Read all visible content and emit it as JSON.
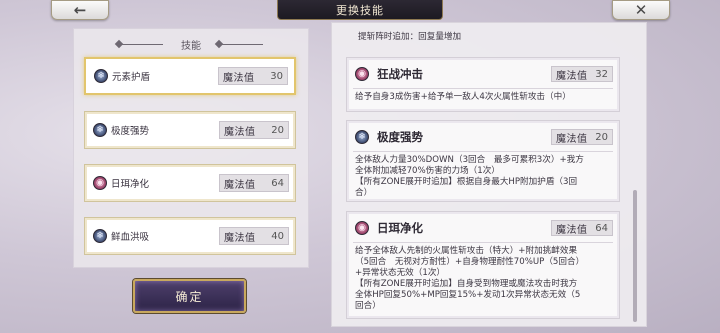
{
  "header": {
    "title": "更换技能",
    "back_icon": "arrow-left-icon",
    "close_icon": "close-icon"
  },
  "left_panel": {
    "title": "技能",
    "slots": [
      {
        "name": "元素护盾",
        "mp_label": "魔法值",
        "mp": "30",
        "icon": "shield-rune-icon"
      },
      {
        "name": "极度强势",
        "mp_label": "魔法值",
        "mp": "20",
        "icon": "power-rune-icon"
      },
      {
        "name": "日珥净化",
        "mp_label": "魔法值",
        "mp": "64",
        "icon": "solar-rune-icon"
      },
      {
        "name": "鲜血洪吸",
        "mp_label": "魔法值",
        "mp": "40",
        "icon": "blood-rune-icon"
      }
    ],
    "confirm_label": "确定"
  },
  "right_panel": {
    "partial_text": "提斩阵时追加：回复量增加",
    "cards": [
      {
        "title": "狂战冲击",
        "mp_label": "魔法值",
        "mp": "32",
        "desc": "给予自身3成伤害+给予单一敌人4次火属性斩攻击（中）"
      },
      {
        "title": "极度强势",
        "mp_label": "魔法值",
        "mp": "20",
        "desc": "全体敌人力量30%DOWN（3回合　最多可累积3次）+我方\n全体附加减轻70%伤害的力场（1次）\n【所有ZONE展开时追加】根据自身最大HP附加护盾（3回\n合）"
      },
      {
        "title": "日珥净化",
        "mp_label": "魔法值",
        "mp": "64",
        "desc": "给予全体敌人先制的火属性斩攻击（特大）+附加挑衅效果\n（5回合　无视对方耐性）+自身物理耐性70%UP（5回合）\n+异常状态无效（1次）\n【所有ZONE展开时追加】自身受到物理或魔法攻击时我方\n全体HP回复50%+MP回复15%+发动1次异常状态无效（5\n回合）"
      }
    ]
  },
  "colors": {
    "accent_gold": "#c8a85e",
    "confirm_bg": "#3a2f57",
    "title_bar_bg": "#23202a"
  }
}
